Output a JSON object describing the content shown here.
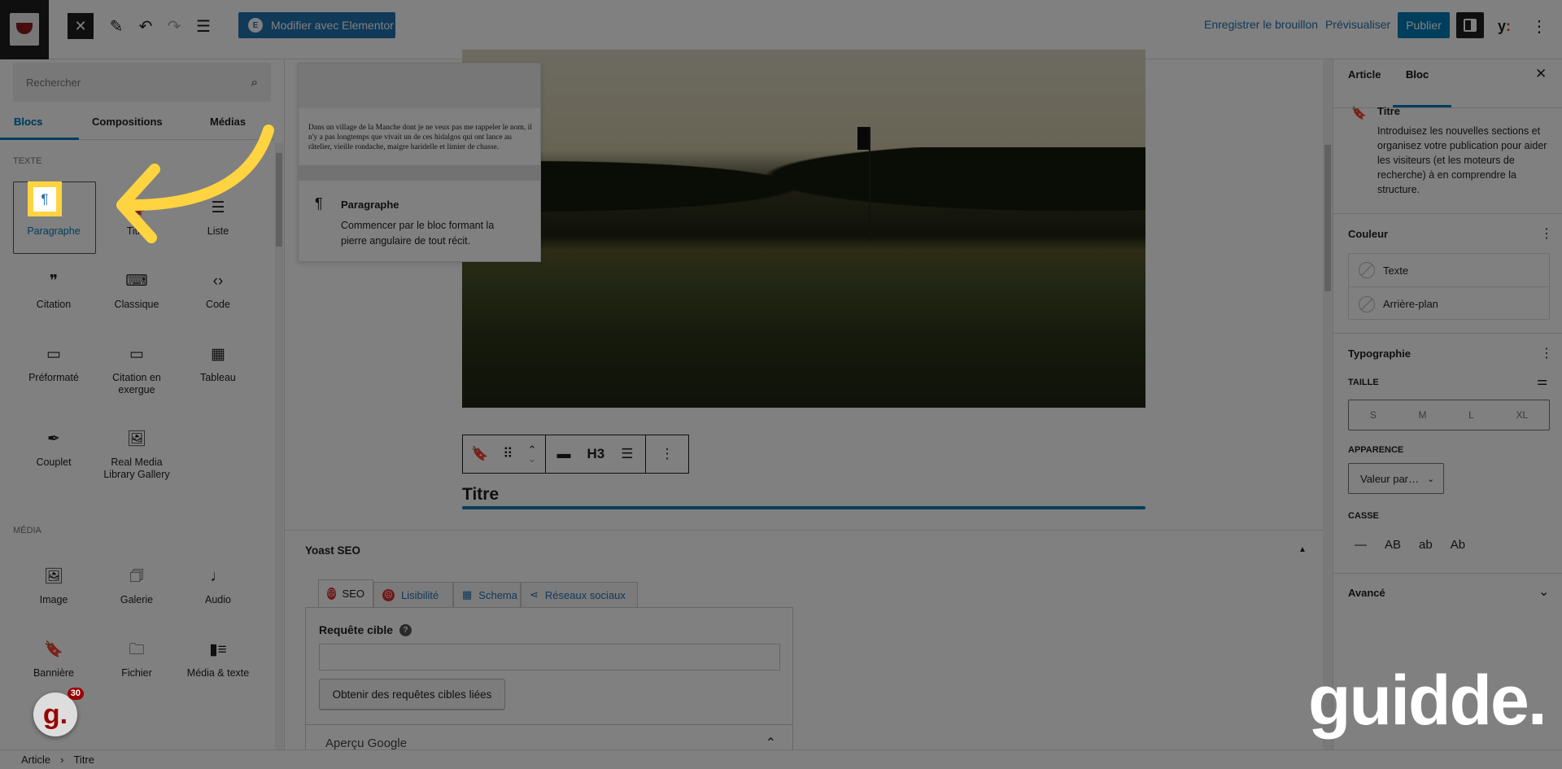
{
  "topbar": {
    "elementor_label": "Modifier avec Elementor",
    "save_draft": "Enregistrer le brouillon",
    "preview": "Prévisualiser",
    "publish": "Publier",
    "icons": [
      "close-icon",
      "pen-icon",
      "undo-icon",
      "redo-icon",
      "list-view-icon",
      "sidebar-toggle-icon",
      "yoast-icon",
      "more-vertical-icon"
    ]
  },
  "inserter": {
    "search_placeholder": "Rechercher",
    "tabs": [
      "Blocs",
      "Compositions",
      "Médias"
    ],
    "active_tab": "Blocs",
    "sections": [
      {
        "label": "Texte",
        "blocks": [
          {
            "label": "Paragraphe",
            "icon": "¶"
          },
          {
            "label": "Titre",
            "icon": "🔖"
          },
          {
            "label": "Liste",
            "icon": "☰"
          },
          {
            "label": "Citation",
            "icon": "❞"
          },
          {
            "label": "Classique",
            "icon": "⌨"
          },
          {
            "label": "Code",
            "icon": "‹›"
          },
          {
            "label": "Préformaté",
            "icon": "▭"
          },
          {
            "label": "Citation en exergue",
            "icon": "▭"
          },
          {
            "label": "Tableau",
            "icon": "▦"
          },
          {
            "label": "Couplet",
            "icon": "✒"
          },
          {
            "label": "Real Media Library Gallery",
            "icon": "🖼"
          }
        ]
      },
      {
        "label": "Média",
        "blocks": [
          {
            "label": "Image",
            "icon": "🖼"
          },
          {
            "label": "Galerie",
            "icon": "🗇"
          },
          {
            "label": "Audio",
            "icon": "♩"
          },
          {
            "label": "Bannière",
            "icon": "🔖"
          },
          {
            "label": "Fichier",
            "icon": "🗀"
          },
          {
            "label": "Média & texte",
            "icon": "▮≡"
          }
        ]
      }
    ]
  },
  "preview": {
    "sample_text": "Dans un village de la Manche dont je ne veux pas me rappeler le nom, il n'y a pas longtemps que vivait un de ces hidalgos qui ont lance au râtelier, vieille rondache, maigre haridelle et limier de chasse.",
    "title": "Paragraphe",
    "description": "Commencer par le bloc formant la pierre angulaire de tout récit."
  },
  "editor": {
    "heading_level": "H3",
    "heading_text": "Titre"
  },
  "yoast": {
    "title": "Yoast SEO",
    "tabs": [
      "SEO",
      "Lisibilité",
      "Schema",
      "Réseaux sociaux"
    ],
    "focus_label": "Requête cible",
    "focus_value": "",
    "related_button": "Obtenir des requêtes cibles liées",
    "google_preview": "Aperçu Google"
  },
  "sidebar": {
    "tabs": [
      "Article",
      "Bloc"
    ],
    "active_tab": "Bloc",
    "block_name": "Titre",
    "block_description": "Introduisez les nouvelles sections et organisez votre publication pour aider les visiteurs (et les moteurs de recherche) à en comprendre la structure.",
    "color_title": "Couleur",
    "color_items": [
      "Texte",
      "Arrière-plan"
    ],
    "typo_title": "Typographie",
    "size_label": "Taille",
    "sizes": [
      "S",
      "M",
      "L",
      "XL"
    ],
    "appearance_label": "Apparence",
    "appearance_value": "Valeur par…",
    "case_label": "Casse",
    "case_options": [
      "—",
      "AB",
      "ab",
      "Ab"
    ],
    "advanced": "Avancé"
  },
  "breadcrumb": [
    "Article",
    "Titre"
  ],
  "guidde": {
    "badge_letter": "g.",
    "badge_count": "30",
    "wordmark": "guidde."
  },
  "colors": {
    "accent": "#007cba",
    "highlight": "#ffd440",
    "overlay": "rgba(0,0,0,0.5)"
  }
}
